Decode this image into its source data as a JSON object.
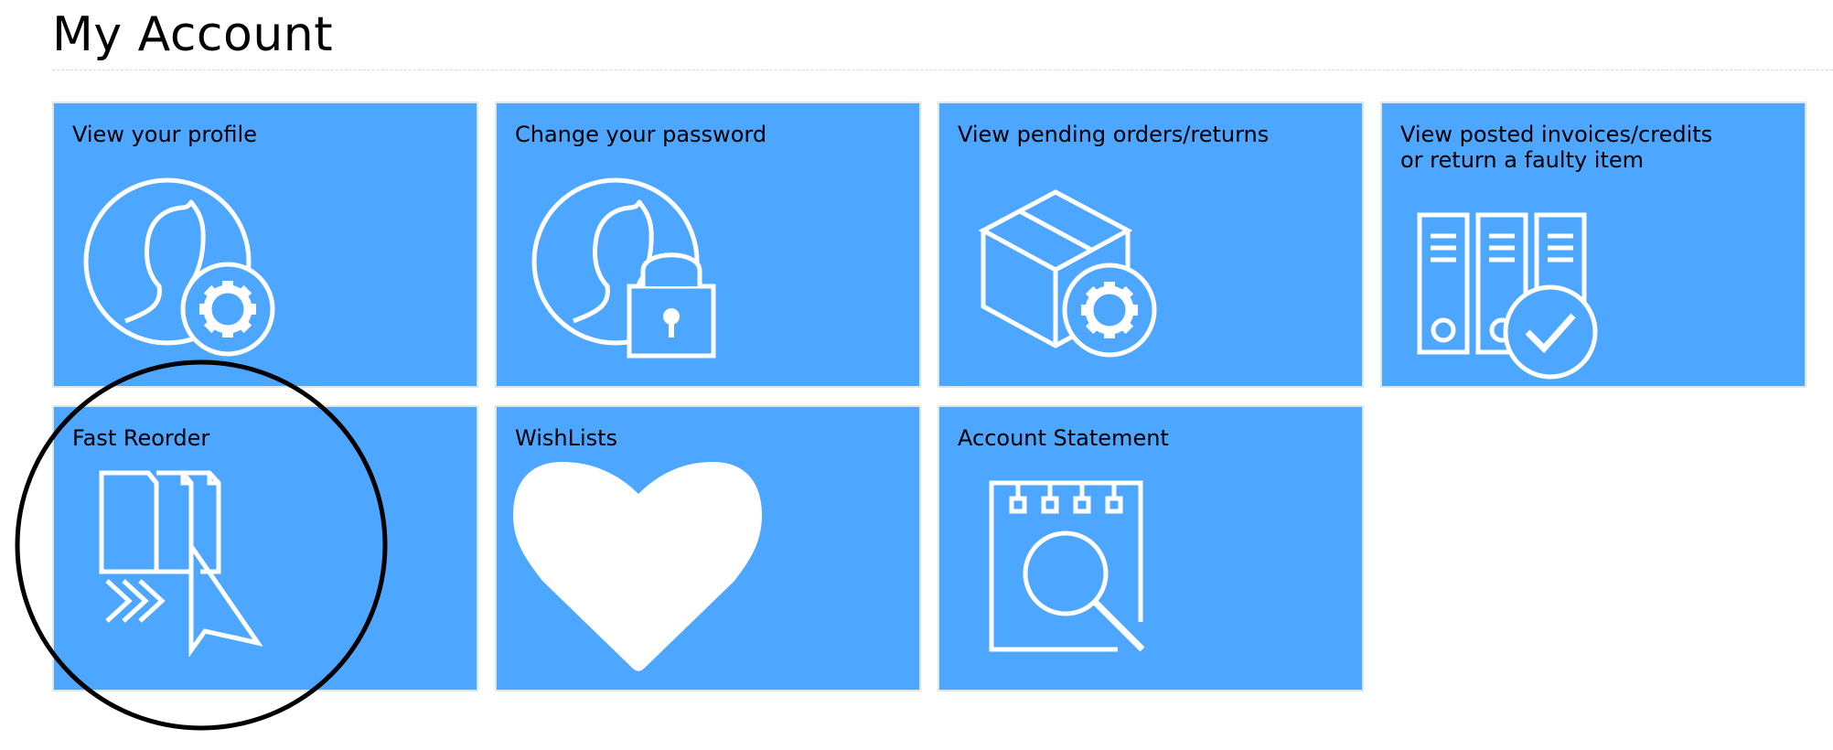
{
  "page": {
    "title": "My Account"
  },
  "tiles": [
    {
      "label": "View your profile",
      "icon": "profile-settings-icon"
    },
    {
      "label": "Change your password",
      "icon": "profile-lock-icon"
    },
    {
      "label": "View pending orders/returns",
      "icon": "box-settings-icon"
    },
    {
      "label": "View posted invoices/credits\nor return a faulty item",
      "icon": "binders-check-icon"
    },
    {
      "label": "Fast Reorder",
      "icon": "fast-reorder-icon"
    },
    {
      "label": "WishLists",
      "icon": "heart-icon"
    },
    {
      "label": "Account Statement",
      "icon": "statement-search-icon"
    }
  ],
  "colors": {
    "tile_background": "#4da6ff",
    "tile_border": "#d7e7f5",
    "icon_stroke": "#ffffff",
    "annotation_circle": "#000000"
  }
}
